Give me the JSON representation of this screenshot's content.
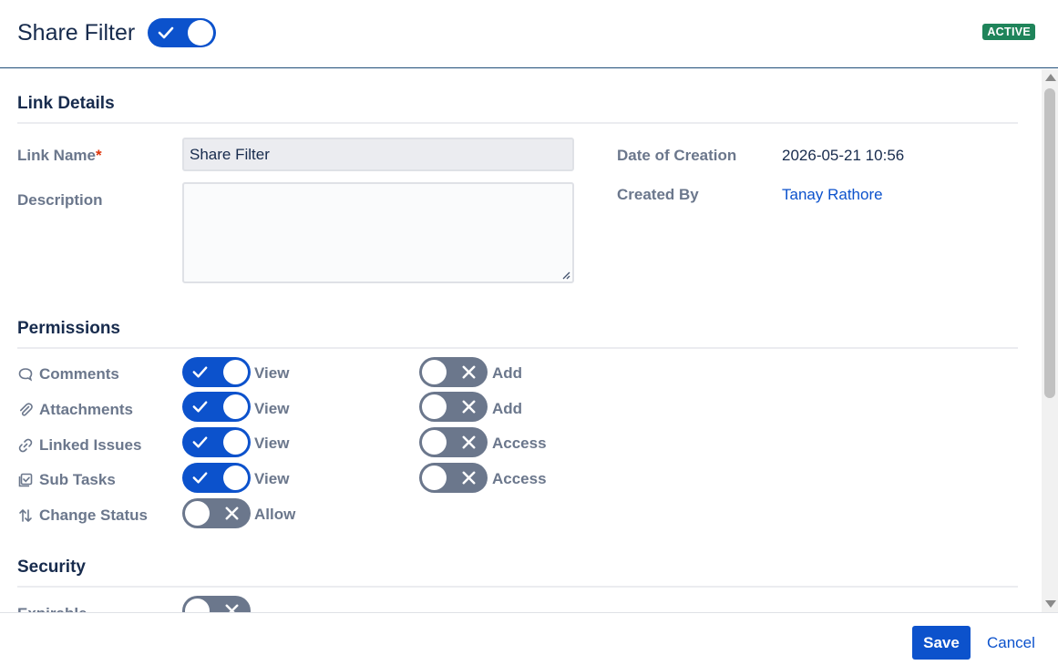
{
  "header": {
    "title": "Share Filter",
    "enabled": true,
    "status_badge": "ACTIVE"
  },
  "link_details": {
    "section_title": "Link Details",
    "link_name_label": "Link Name",
    "required_marker": "*",
    "link_name_value": "Share Filter",
    "description_label": "Description",
    "description_value": "",
    "date_label": "Date of Creation",
    "date_value": "2026-05-21 10:56",
    "created_by_label": "Created By",
    "created_by_value": "Tanay Rathore"
  },
  "permissions": {
    "section_title": "Permissions",
    "rows": [
      {
        "label": "Comments",
        "icon": "comment-icon",
        "primary": {
          "on": true,
          "label": "View"
        },
        "secondary": {
          "on": false,
          "label": "Add"
        }
      },
      {
        "label": "Attachments",
        "icon": "paperclip-icon",
        "primary": {
          "on": true,
          "label": "View"
        },
        "secondary": {
          "on": false,
          "label": "Add"
        }
      },
      {
        "label": "Linked Issues",
        "icon": "link-icon",
        "primary": {
          "on": true,
          "label": "View"
        },
        "secondary": {
          "on": false,
          "label": "Access"
        }
      },
      {
        "label": "Sub Tasks",
        "icon": "subtask-icon",
        "primary": {
          "on": true,
          "label": "View"
        },
        "secondary": {
          "on": false,
          "label": "Access"
        }
      },
      {
        "label": "Change Status",
        "icon": "transition-icon",
        "primary": {
          "on": false,
          "label": "Allow"
        }
      }
    ]
  },
  "security": {
    "section_title": "Security",
    "expirable_label": "Expirable",
    "expirable_on": false
  },
  "footer": {
    "save_label": "Save",
    "cancel_label": "Cancel"
  },
  "colors": {
    "primary": "#0c52cc",
    "toggle_off": "#6b778c",
    "active_badge": "#1f845a",
    "required": "#de350b"
  }
}
